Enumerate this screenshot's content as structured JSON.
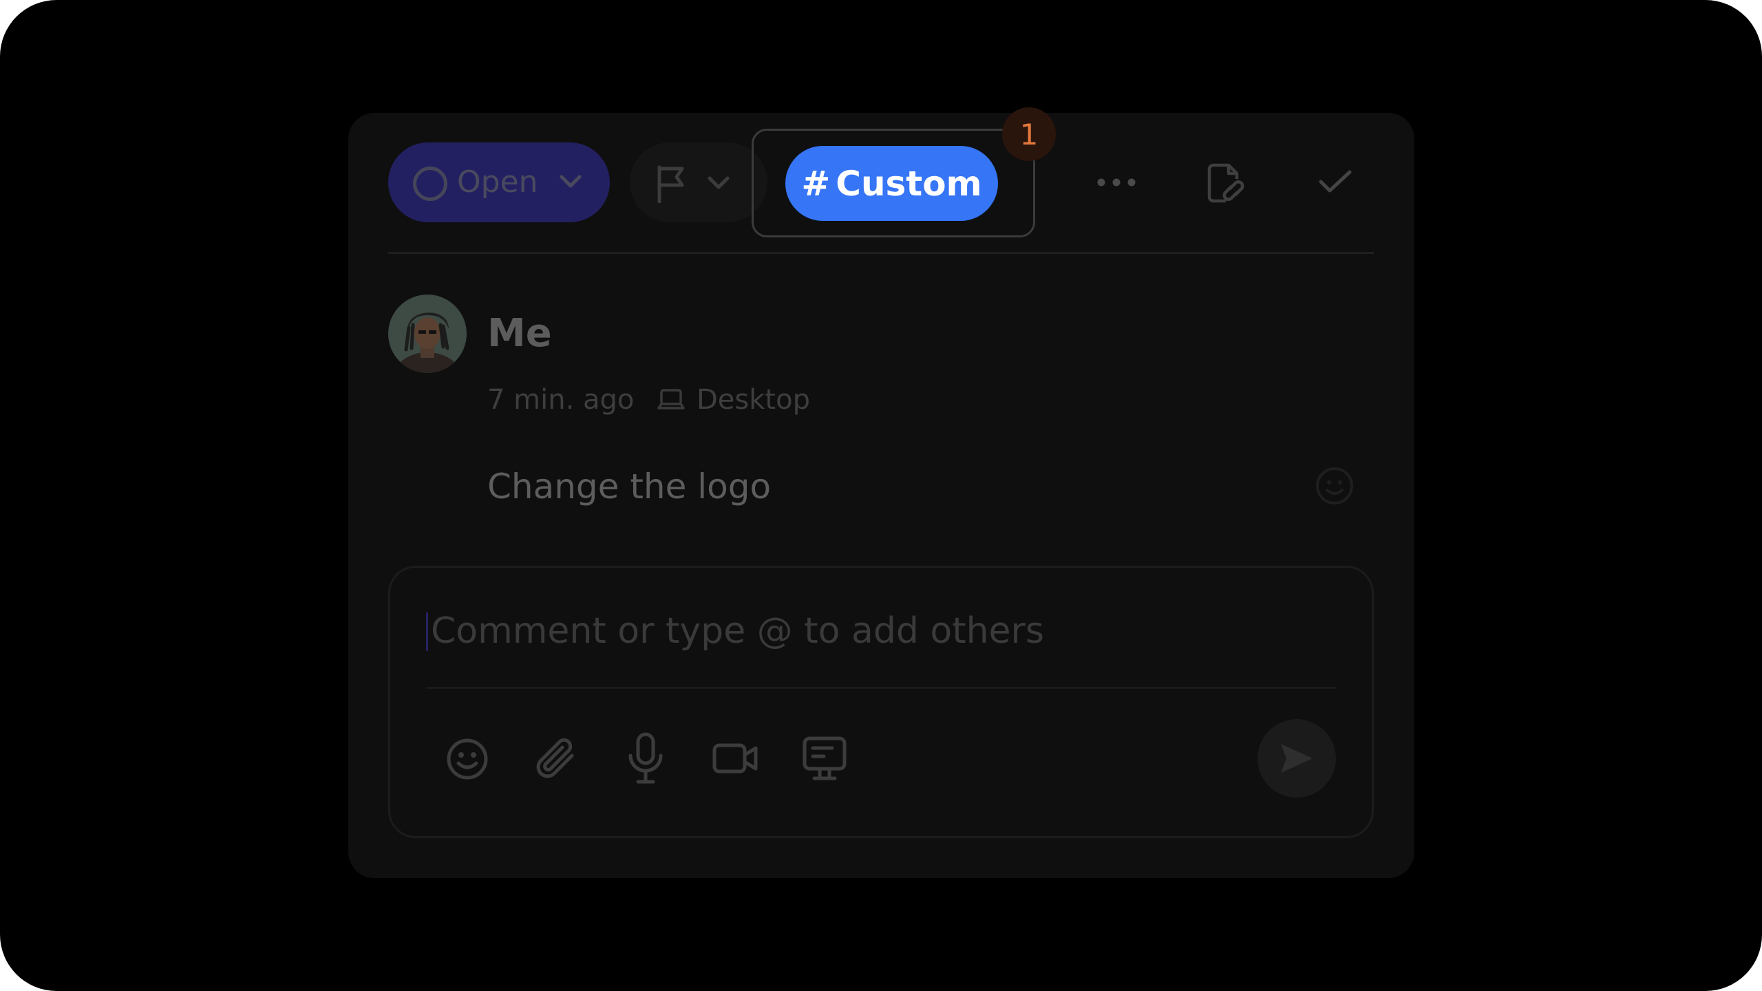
{
  "toolbar": {
    "status_label": "Open",
    "custom_label": "Custom",
    "custom_hash": "#",
    "badge_count": "1"
  },
  "comment": {
    "author": "Me",
    "time": "7 min. ago",
    "device": "Desktop",
    "text": "Change the logo"
  },
  "composer": {
    "placeholder": "Comment or type @ to add others"
  },
  "icons": [
    "circle-status-icon",
    "chevron-down-icon",
    "flag-icon",
    "more-icon",
    "link-file-icon",
    "check-icon",
    "laptop-icon",
    "reaction-icon",
    "emoji-icon",
    "attachment-icon",
    "microphone-icon",
    "video-icon",
    "screen-icon",
    "send-icon"
  ],
  "colors": {
    "accent": "#3575f6",
    "status_bg": "#232062",
    "badge_text": "#e3783c",
    "badge_bg": "#2a150d"
  }
}
